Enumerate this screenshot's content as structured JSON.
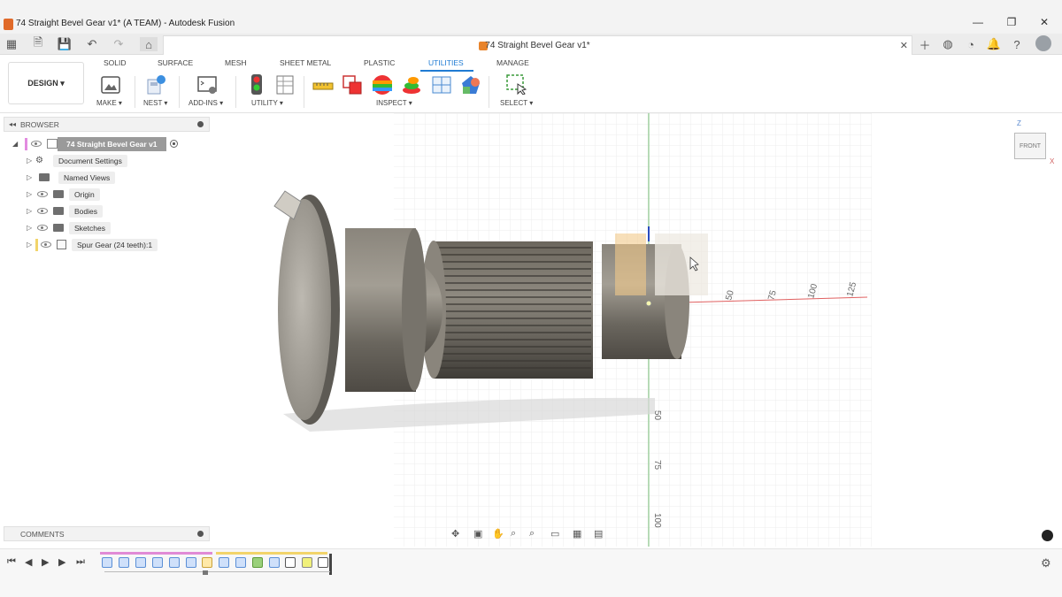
{
  "window": {
    "title": "74 Straight Bevel Gear v1* (A TEAM) - Autodesk Fusion",
    "min": "—",
    "restore": "❐",
    "close": "✕"
  },
  "document_tab": {
    "title": "74 Straight Bevel Gear v1*",
    "close": "✕"
  },
  "workspace": "DESIGN ▾",
  "ribbon_tabs": [
    "SOLID",
    "SURFACE",
    "MESH",
    "SHEET METAL",
    "PLASTIC",
    "UTILITIES",
    "MANAGE"
  ],
  "ribbon_active_tab": "UTILITIES",
  "ribbon_groups": {
    "make": "MAKE ▾",
    "nest": "NEST ▾",
    "addins": "ADD-INS ▾",
    "utility": "UTILITY ▾",
    "inspect": "INSPECT ▾",
    "select": "SELECT ▾"
  },
  "browser": {
    "title": "BROWSER",
    "root": "74 Straight Bevel Gear v1",
    "items": [
      {
        "label": "Document Settings",
        "icon": "gear-icon"
      },
      {
        "label": "Named Views",
        "icon": "folder-icon"
      },
      {
        "label": "Origin",
        "icon": "folder-icon"
      },
      {
        "label": "Bodies",
        "icon": "folder-icon"
      },
      {
        "label": "Sketches",
        "icon": "folder-icon"
      },
      {
        "label": "Spur Gear (24 teeth):1",
        "icon": "component-icon"
      }
    ]
  },
  "comments": {
    "title": "COMMENTS"
  },
  "viewcube": {
    "face": "FRONT",
    "z": "Z",
    "x": "X"
  },
  "axis_ticks_horizontal": [
    "50",
    "75",
    "100",
    "125"
  ],
  "axis_ticks_vertical": [
    "50",
    "75",
    "100"
  ],
  "colors": {
    "accent": "#1f7bd3",
    "gear_body": "#6e6a62",
    "timeline_feature": "#5b8fd6",
    "timeline_bar_pink": "#e08ad6",
    "timeline_bar_yellow": "#f2d46a"
  }
}
